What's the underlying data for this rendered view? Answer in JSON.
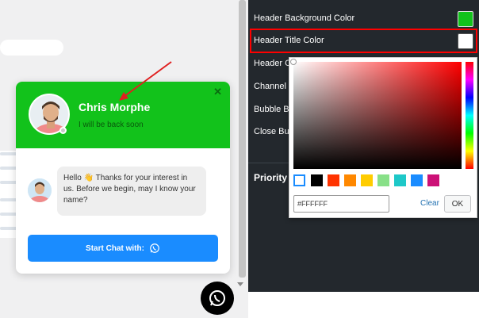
{
  "chat": {
    "agent_name": "Chris Morphe",
    "agent_status": "I will be back soon",
    "greeting": "Hello 👋 Thanks for your interest in us. Before we begin, may I know your name?",
    "start_button_label": "Start Chat with:",
    "close_label": "✕"
  },
  "settings": {
    "header_bg_label": "Header Background Color",
    "header_title_label": "Header Title Color",
    "header_caption_label": "Header Ca",
    "channel_label": "Channel Ic",
    "bubble_label": "Bubble Bu",
    "close_label": "Close Butt",
    "priority_label": "Priority",
    "header_bg_color": "#12c21b",
    "header_title_color": "#ffffff"
  },
  "picker": {
    "hex_value": "#FFFFFF",
    "clear_label": "Clear",
    "ok_label": "OK",
    "presets": [
      "#ffffff",
      "#000000",
      "#ff3300",
      "#ff8800",
      "#ffcc00",
      "#88e088",
      "#1ec8c8",
      "#1a8cff",
      "#cc1177"
    ]
  },
  "icons": {
    "whatsapp": "whatsapp-icon",
    "close": "close-icon",
    "arrow": "annotation-arrow"
  }
}
